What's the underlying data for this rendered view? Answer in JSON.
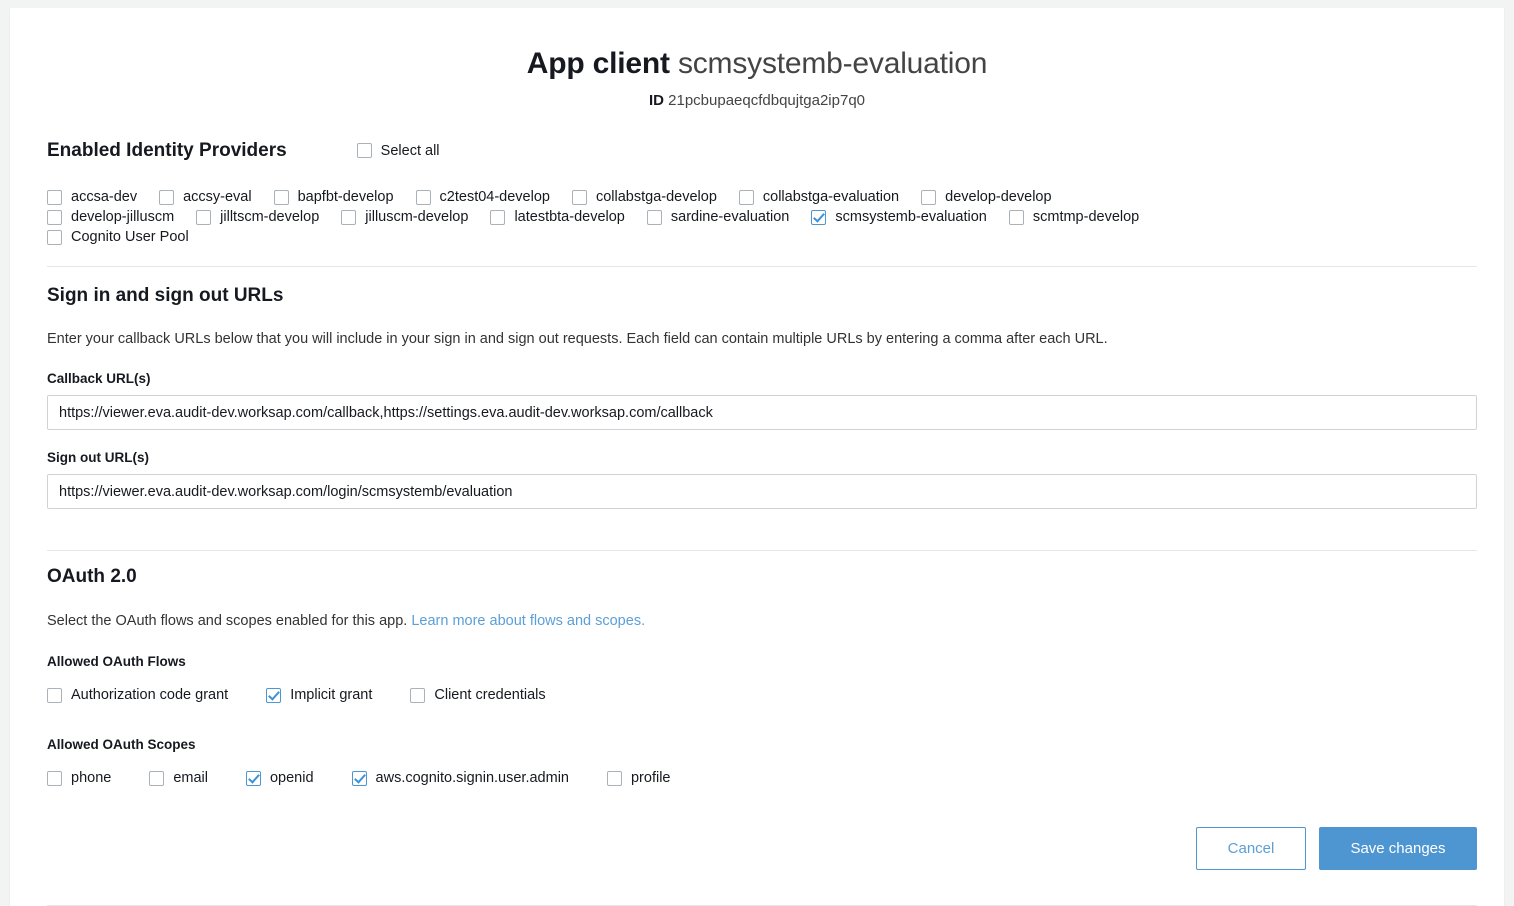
{
  "header": {
    "title_strong": "App client",
    "title_rest": "scmsystemb-evaluation",
    "id_label": "ID",
    "id_value": "21pcbupaeqcfdbqujtga2ip7q0"
  },
  "identity_providers": {
    "heading": "Enabled Identity Providers",
    "select_all_label": "Select all",
    "select_all_checked": false,
    "rows": [
      [
        {
          "label": "accsa-dev",
          "checked": false
        },
        {
          "label": "accsy-eval",
          "checked": false
        },
        {
          "label": "bapfbt-develop",
          "checked": false
        },
        {
          "label": "c2test04-develop",
          "checked": false
        },
        {
          "label": "collabstga-develop",
          "checked": false
        },
        {
          "label": "collabstga-evaluation",
          "checked": false
        },
        {
          "label": "develop-develop",
          "checked": false
        }
      ],
      [
        {
          "label": "develop-jilluscm",
          "checked": false
        },
        {
          "label": "jilltscm-develop",
          "checked": false
        },
        {
          "label": "jilluscm-develop",
          "checked": false
        },
        {
          "label": "latestbta-develop",
          "checked": false
        },
        {
          "label": "sardine-evaluation",
          "checked": false
        },
        {
          "label": "scmsystemb-evaluation",
          "checked": true
        },
        {
          "label": "scmtmp-develop",
          "checked": false
        }
      ],
      [
        {
          "label": "Cognito User Pool",
          "checked": false
        }
      ]
    ]
  },
  "urls": {
    "heading": "Sign in and sign out URLs",
    "description": "Enter your callback URLs below that you will include in your sign in and sign out requests. Each field can contain multiple URLs by entering a comma after each URL.",
    "callback_label": "Callback URL(s)",
    "callback_value": "https://viewer.eva.audit-dev.worksap.com/callback,https://settings.eva.audit-dev.worksap.com/callback",
    "callback_placeholder": "",
    "signout_label": "Sign out URL(s)",
    "signout_value": "https://viewer.eva.audit-dev.worksap.com/login/scmsystemb/evaluation",
    "signout_placeholder": ""
  },
  "oauth": {
    "heading": "OAuth 2.0",
    "description_text": "Select the OAuth flows and scopes enabled for this app.",
    "description_link": "Learn more about flows and scopes.",
    "flows_label": "Allowed OAuth Flows",
    "flows": [
      {
        "label": "Authorization code grant",
        "checked": false
      },
      {
        "label": "Implicit grant",
        "checked": true
      },
      {
        "label": "Client credentials",
        "checked": false
      }
    ],
    "scopes_label": "Allowed OAuth Scopes",
    "scopes": [
      {
        "label": "phone",
        "checked": false
      },
      {
        "label": "email",
        "checked": false
      },
      {
        "label": "openid",
        "checked": true
      },
      {
        "label": "aws.cognito.signin.user.admin",
        "checked": true
      },
      {
        "label": "profile",
        "checked": false
      }
    ]
  },
  "actions": {
    "cancel_label": "Cancel",
    "save_label": "Save changes"
  },
  "colors": {
    "accent": "#4d96d2",
    "link": "#5b9fd8",
    "page_bg": "#f2f3f3",
    "divider": "#e6e6e6"
  }
}
